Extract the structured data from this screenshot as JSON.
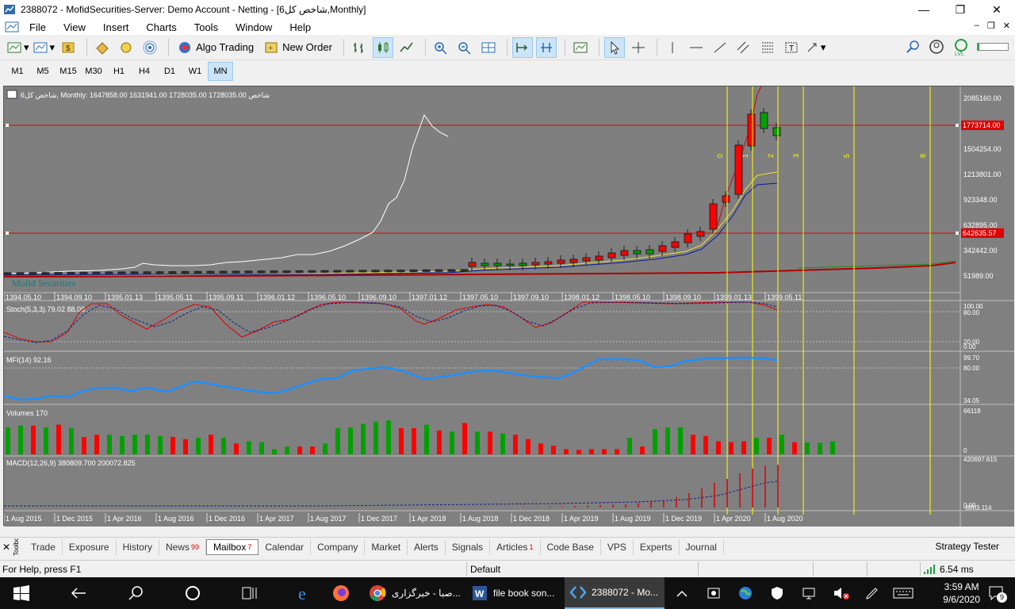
{
  "window": {
    "title": "2388072 - MofidSecurities-Server: Demo Account - Netting - [شاخص کل6,Monthly]",
    "minimize": "—",
    "maximize": "❐",
    "close": "✕"
  },
  "menu": {
    "items": [
      "File",
      "View",
      "Insert",
      "Charts",
      "Tools",
      "Window",
      "Help"
    ],
    "mdi_minimize": "–",
    "mdi_restore": "❐",
    "mdi_close": "✕"
  },
  "toolbar": {
    "algo_trading": "Algo Trading",
    "new_order": "New Order"
  },
  "timeframes": {
    "items": [
      "M1",
      "M5",
      "M15",
      "M30",
      "H1",
      "H4",
      "D1",
      "W1",
      "MN"
    ],
    "active": "MN"
  },
  "chart": {
    "header": "شاخص کل6, Monthly:  1647858.00  1631941.00  1728035.00  1728035.00   شاخص",
    "watermark": "Mofid Securities",
    "price_ticks": [
      "2085160.00",
      "1504254.00",
      "1213801.00",
      "923348.00",
      "632895.00",
      "342442.00",
      "51989.00"
    ],
    "price_lines": [
      "1773714.00",
      "642635.57"
    ],
    "top_time_labels": [
      "1394.05.10",
      "1394.09.10",
      "1395.01.13",
      "1395.05.11",
      "1395.09.11",
      "1396.01.12",
      "1396.05.10",
      "1396.09.10",
      "1397.01.12",
      "1397.05.10",
      "1397.09.10",
      "1398.01.12",
      "1398.05.10",
      "1398.09.10",
      "1399.01.13",
      "1399.05.11"
    ],
    "fib_labels": [
      "0",
      "1",
      "2",
      "3",
      "5",
      "8"
    ],
    "stoch_label": "Stoch(5,3,3) 79.02 88.09",
    "stoch_ticks": [
      "100.00",
      "80.00",
      "20.00",
      "0.00"
    ],
    "mfi_label": "MFI(14) 92.16",
    "mfi_ticks": [
      "99.70",
      "80.00",
      "34.05"
    ],
    "volume_label": "Volumes 170",
    "volume_ticks": [
      "66118",
      "0"
    ],
    "macd_label": "MACD(12,26,9) 380809.700 200072.825",
    "macd_ticks": [
      "420697.615",
      "0.00",
      "-8003.114"
    ],
    "bottom_time_labels": [
      "1 Aug 2015",
      "1 Dec 2015",
      "1 Apr 2016",
      "1 Aug 2016",
      "1 Dec 2016",
      "1 Apr 2017",
      "1 Aug 2017",
      "1 Dec 2017",
      "1 Apr 2018",
      "1 Aug 2018",
      "1 Dec 2018",
      "1 Apr 2019",
      "1 Aug 2019",
      "1 Dec 2019",
      "1 Apr 2020",
      "1 Aug 2020"
    ],
    "colors": {
      "background": "#808080",
      "bear": "#ff0000",
      "bull": "#00a000",
      "stoch_main": "#e00000",
      "stoch_signal": "#102080",
      "mfi": "#1e90ff",
      "fib": "#ffff00",
      "hline": "#e00000"
    },
    "volumes": [
      0.62,
      0.66,
      0.66,
      0.62,
      0.68,
      0.6,
      0.4,
      0.45,
      0.45,
      0.42,
      0.45,
      0.45,
      0.42,
      0.4,
      0.35,
      0.38,
      0.45,
      0.38,
      0.25,
      0.3,
      0.28,
      0.12,
      0.18,
      0.18,
      0.18,
      0.25,
      0.6,
      0.62,
      0.7,
      0.75,
      0.78,
      0.6,
      0.6,
      0.68,
      0.55,
      0.52,
      0.72,
      0.52,
      0.52,
      0.48,
      0.45,
      0.35,
      0.25,
      0.2,
      0.12,
      0.1,
      0.12,
      0.12,
      0.12,
      0.38,
      0.18,
      0.58,
      0.62,
      0.62,
      0.45,
      0.42,
      0.3,
      0.28,
      0.3,
      0.38,
      0.38,
      0.45,
      0.28,
      0.27,
      0.27,
      0.3
    ],
    "volume_bull": [
      true,
      true,
      false,
      true,
      false,
      true,
      false,
      false,
      true,
      true,
      true,
      true,
      true,
      false,
      false,
      true,
      false,
      true,
      false,
      true,
      true,
      true,
      true,
      false,
      false,
      true,
      true,
      true,
      true,
      true,
      true,
      false,
      false,
      true,
      false,
      true,
      false,
      true,
      false,
      true,
      false,
      false,
      false,
      false,
      false,
      false,
      false,
      false,
      false,
      true,
      false,
      true,
      true,
      true,
      false,
      false,
      false,
      false,
      false,
      true,
      false,
      true,
      false,
      true,
      true,
      true
    ]
  },
  "bottom_tabs": {
    "toolbox": "Toolbox",
    "items": [
      {
        "label": "Trade",
        "badge": ""
      },
      {
        "label": "Exposure",
        "badge": ""
      },
      {
        "label": "History",
        "badge": ""
      },
      {
        "label": "News",
        "badge": "99"
      },
      {
        "label": "Mailbox",
        "badge": "7"
      },
      {
        "label": "Calendar",
        "badge": ""
      },
      {
        "label": "Company",
        "badge": ""
      },
      {
        "label": "Market",
        "badge": ""
      },
      {
        "label": "Alerts",
        "badge": ""
      },
      {
        "label": "Signals",
        "badge": ""
      },
      {
        "label": "Articles",
        "badge": "1"
      },
      {
        "label": "Code Base",
        "badge": ""
      },
      {
        "label": "VPS",
        "badge": ""
      },
      {
        "label": "Experts",
        "badge": ""
      },
      {
        "label": "Journal",
        "badge": ""
      }
    ],
    "active": "Mailbox",
    "strategy_tester": "Strategy Tester"
  },
  "status": {
    "help": "For Help, press F1",
    "profile": "Default",
    "ping": "6.54 ms"
  },
  "taskbar": {
    "tasks": [
      "صبا - خبرگزاری...",
      "file book son...",
      "2388072 - Mo..."
    ],
    "time": "3:59 AM",
    "date": "9/6/2020",
    "notifications": "9"
  }
}
